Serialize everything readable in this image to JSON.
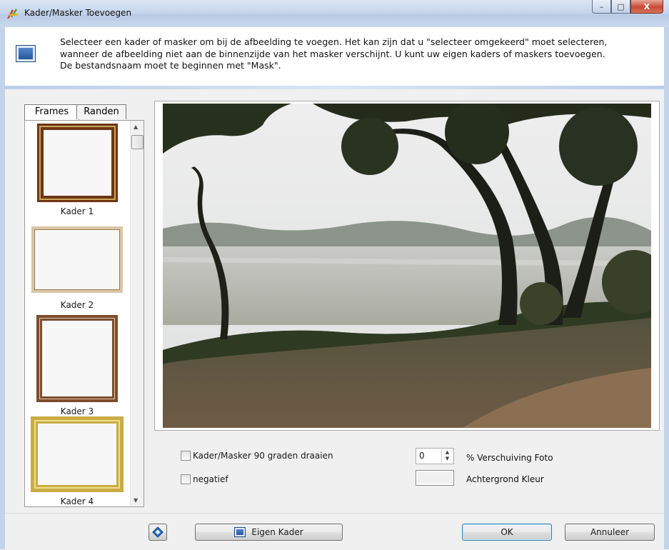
{
  "window": {
    "title": "Kader/Masker Toevoegen",
    "controls": {
      "minimize": "–",
      "maximize": "□",
      "close": "X"
    }
  },
  "info": {
    "lines": [
      "Selecteer een kader of masker om bij de afbeelding te voegen. Het kan zijn dat u \"selecteer omgekeerd\" moet selecteren,",
      "wanneer de afbeelding niet aan de binnenzijde van het masker verschijnt. U kunt uw eigen kaders of maskers toevoegen.",
      "De bestandsnaam moet te beginnen met \"Mask\"."
    ]
  },
  "tabs": [
    {
      "label": "Frames",
      "active": true
    },
    {
      "label": "Randen",
      "active": false
    }
  ],
  "frames": [
    {
      "label": "Kader 1"
    },
    {
      "label": "Kader 2"
    },
    {
      "label": "Kader 3"
    },
    {
      "label": "Kader 4"
    }
  ],
  "options": {
    "rotate_label": "Kader/Masker 90 graden draaien",
    "rotate_checked": false,
    "negative_label": "negatief",
    "negative_checked": false,
    "shift_value": "0",
    "shift_label": "% Verschuiving Foto",
    "background_label": "Achtergrond Kleur"
  },
  "buttons": {
    "custom_frame": "Eigen Kader",
    "ok": "OK",
    "cancel": "Annuleer"
  },
  "colors": {
    "title_gradient": "#c6d6ec",
    "close_button": "#c94a35",
    "frame_edge": "#c3d4ea"
  },
  "icons": {
    "app": "paint-palette-icon",
    "info": "monitor-icon",
    "small_button": "diamond-icon"
  }
}
